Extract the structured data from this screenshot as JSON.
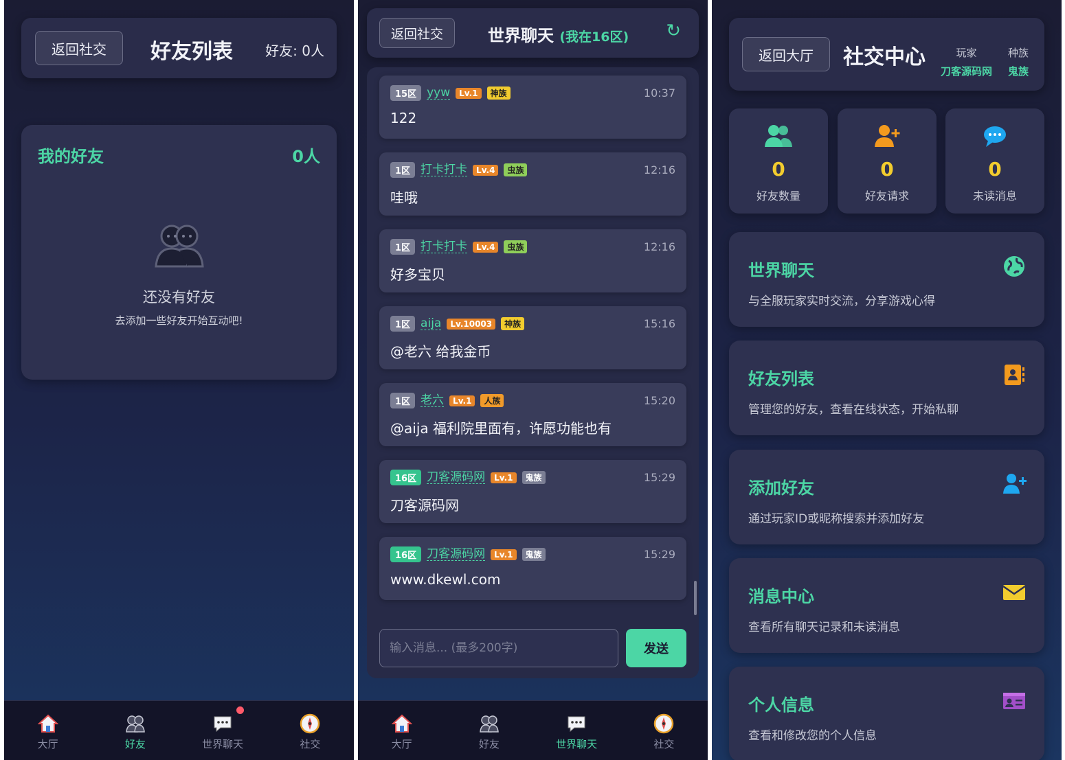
{
  "screen_friends": {
    "back_label": "返回社交",
    "title": "好友列表",
    "friend_count_label": "好友: 0人",
    "section_title": "我的好友",
    "section_count": "0人",
    "empty_title": "还没有好友",
    "empty_subtitle": "去添加一些好友开始互动吧!"
  },
  "screen_chat": {
    "back_label": "返回社交",
    "title": "世界聊天",
    "zone_label": "(我在16区)",
    "refresh_icon": "↻",
    "messages": [
      {
        "zone": "15区",
        "user": "yyw",
        "level": "Lv.1",
        "race": "神族",
        "time": "10:37",
        "text": "122"
      },
      {
        "zone": "1区",
        "user": "打卡打卡",
        "level": "Lv.4",
        "race": "虫族",
        "time": "12:16",
        "text": "哇哦"
      },
      {
        "zone": "1区",
        "user": "打卡打卡",
        "level": "Lv.4",
        "race": "虫族",
        "time": "12:16",
        "text": "好多宝贝"
      },
      {
        "zone": "1区",
        "user": "aija",
        "level": "Lv.10003",
        "race": "神族",
        "time": "15:16",
        "text": "@老六 给我金币"
      },
      {
        "zone": "1区",
        "user": "老六",
        "level": "Lv.1",
        "race": "人族",
        "time": "15:20",
        "text": "@aija 福利院里面有，许愿功能也有"
      },
      {
        "zone": "16区",
        "user": "刀客源码网",
        "level": "Lv.1",
        "race": "鬼族",
        "time": "15:29",
        "text": "刀客源码网"
      },
      {
        "zone": "16区",
        "user": "刀客源码网",
        "level": "Lv.1",
        "race": "鬼族",
        "time": "15:29",
        "text": "www.dkewl.com"
      }
    ],
    "input_placeholder": "输入消息... (最多200字)",
    "send_label": "发送"
  },
  "screen_social": {
    "back_label": "返回大厅",
    "title": "社交中心",
    "player_key": "玩家",
    "player_value": "刀客源码网",
    "race_key": "种族",
    "race_value": "鬼族",
    "stats": [
      {
        "value": "0",
        "label": "好友数量"
      },
      {
        "value": "0",
        "label": "好友请求"
      },
      {
        "value": "0",
        "label": "未读消息"
      }
    ],
    "features": [
      {
        "title": "世界聊天",
        "desc": "与全服玩家实时交流，分享游戏心得"
      },
      {
        "title": "好友列表",
        "desc": "管理您的好友，查看在线状态，开始私聊"
      },
      {
        "title": "添加好友",
        "desc": "通过玩家ID或昵称搜索并添加好友"
      },
      {
        "title": "消息中心",
        "desc": "查看所有聊天记录和未读消息"
      },
      {
        "title": "个人信息",
        "desc": "查看和修改您的个人信息"
      }
    ]
  },
  "nav": {
    "hall": "大厅",
    "friends": "好友",
    "world_chat": "世界聊天",
    "social": "社交"
  },
  "colors": {
    "accent": "#4cd6a5",
    "stat_number": "#f2cc2e",
    "background_top": "#1b1c33",
    "card": "#2e3150"
  }
}
